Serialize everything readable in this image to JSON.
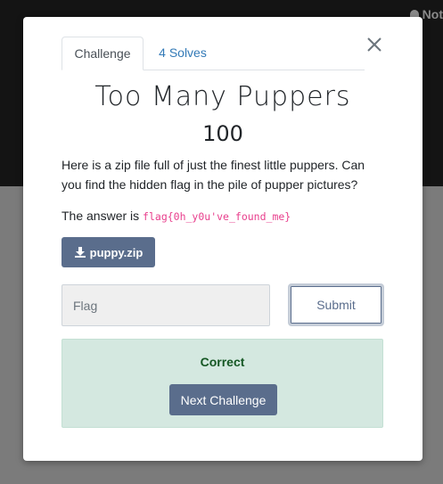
{
  "background": {
    "corner_text": "Not",
    "corner_icon": "lock-icon",
    "top_color": "#141414",
    "overlay_color": "#7b7b7b"
  },
  "modal": {
    "tabs": [
      {
        "label": "Challenge",
        "active": true
      },
      {
        "label": "4 Solves",
        "active": false
      }
    ],
    "close_icon": "close-icon",
    "title": "Too Many Puppers",
    "points": "100",
    "description": "Here is a zip file full of just the finest little puppers. Can you find the hidden flag in the pile of pupper pictures?",
    "answer_prefix": "The answer is ",
    "answer_flag": "flag{0h_y0u've_found_me}",
    "download": {
      "label": "puppy.zip",
      "icon": "download-icon"
    },
    "flag_input": {
      "placeholder": "Flag",
      "value": ""
    },
    "submit_label": "Submit",
    "result": {
      "message": "Correct",
      "next_label": "Next Challenge"
    },
    "colors": {
      "button": "#5a6d8c",
      "success_bg": "#d4e8e0",
      "success_text": "#155724",
      "link": "#337ab7",
      "code": "#e83e8c"
    }
  }
}
